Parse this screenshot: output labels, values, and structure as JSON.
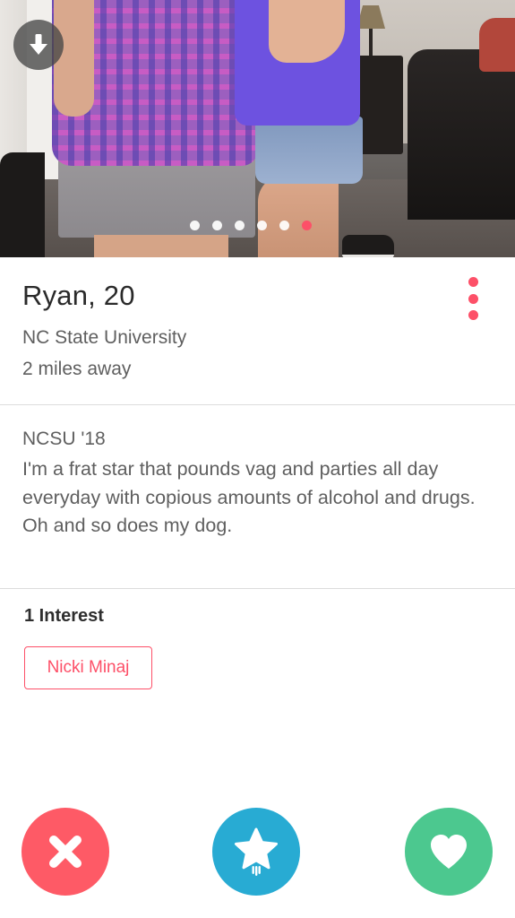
{
  "photo": {
    "dot_count": 6,
    "active_dot_index": 5,
    "download_icon": "arrow-down-icon",
    "accent_color": "#fd5068"
  },
  "profile": {
    "name_age": "Ryan, 20",
    "school": "NC State University",
    "distance": "2 miles away",
    "more_icon": "vertical-ellipsis-icon"
  },
  "bio": {
    "title": "NCSU '18",
    "text": "I'm a frat star that pounds vag and parties all day everyday with copious amounts of alcohol and drugs. Oh and so does my dog."
  },
  "interests": {
    "heading": "1 Interest",
    "items": [
      "Nicki Minaj"
    ]
  },
  "actions": [
    {
      "icon": "close-icon",
      "color": "#fe5a66"
    },
    {
      "icon": "star-icon",
      "color": "#28abd3"
    },
    {
      "icon": "heart-icon",
      "color": "#4cc88f"
    }
  ]
}
